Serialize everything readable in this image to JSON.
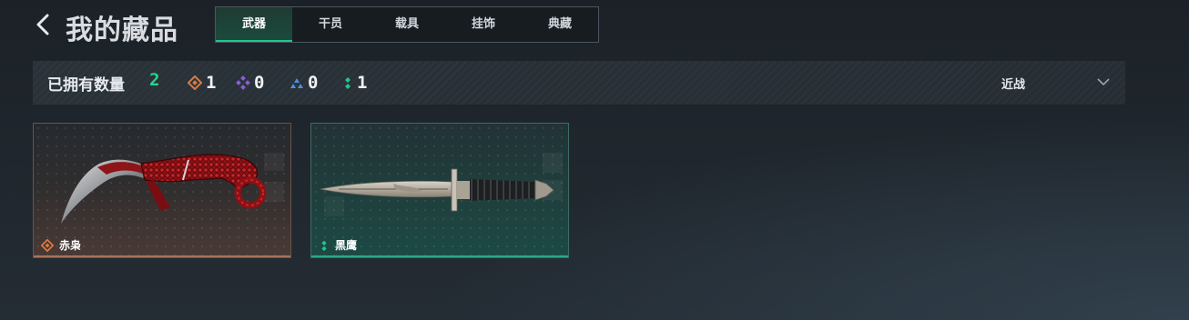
{
  "header": {
    "back_icon": "chevron-left-icon",
    "title": "我的藏品",
    "tabs": [
      {
        "label": "武器",
        "active": true
      },
      {
        "label": "干员",
        "active": false
      },
      {
        "label": "载具",
        "active": false
      },
      {
        "label": "挂饰",
        "active": false
      },
      {
        "label": "典藏",
        "active": false
      }
    ]
  },
  "stats": {
    "owned_label": "已拥有数量",
    "owned_count": "2",
    "rarities": [
      {
        "icon": "orange-diamond-icon",
        "color": "#d97a45",
        "count": "1"
      },
      {
        "icon": "purple-diamond-icon",
        "color": "#8b5fd6",
        "count": "0"
      },
      {
        "icon": "blue-triangle-icon",
        "color": "#4f8fe0",
        "count": "0"
      },
      {
        "icon": "green-dots-icon",
        "color": "#22c68c",
        "count": "1"
      }
    ],
    "category_select": {
      "value": "近战",
      "icon": "chevron-down-icon"
    }
  },
  "items": [
    {
      "name": "赤枭",
      "rarity_icon": "orange-diamond-icon",
      "rarity_color": "#d97a45",
      "image": "karambit-knife-image"
    },
    {
      "name": "黑鹰",
      "rarity_icon": "green-dots-icon",
      "rarity_color": "#22c68c",
      "image": "combat-dagger-image"
    }
  ],
  "colors": {
    "accent": "#22c68c",
    "count_highlight": "#27d28f"
  }
}
